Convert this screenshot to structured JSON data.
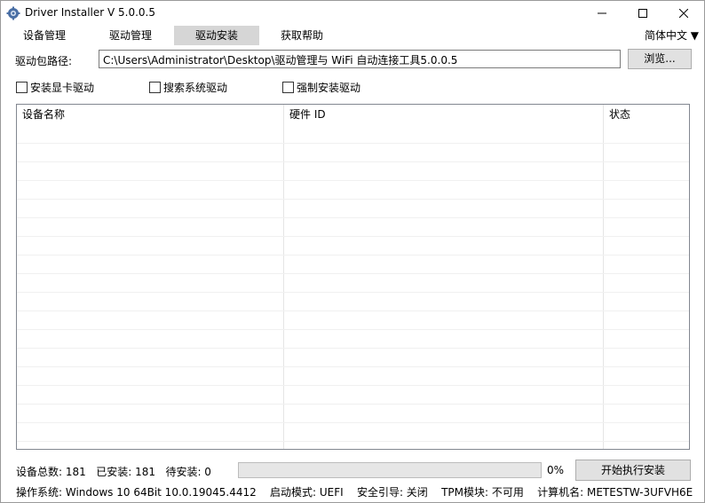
{
  "window": {
    "title": "Driver Installer V 5.0.0.5",
    "icon": "gear-icon"
  },
  "tabs": [
    {
      "label": "设备管理",
      "active": false
    },
    {
      "label": "驱动管理",
      "active": false
    },
    {
      "label": "驱动安装",
      "active": true
    },
    {
      "label": "获取帮助",
      "active": false
    }
  ],
  "language": "简体中文 ▼",
  "path": {
    "label": "驱动包路径:",
    "value": "C:\\Users\\Administrator\\Desktop\\驱动管理与 WiFi 自动连接工具5.0.0.5",
    "browse_label": "浏览..."
  },
  "options": [
    {
      "label": "安装显卡驱动",
      "checked": false
    },
    {
      "label": "搜索系统驱动",
      "checked": false
    },
    {
      "label": "强制安装驱动",
      "checked": false
    }
  ],
  "table": {
    "columns": [
      "设备名称",
      "硬件 ID",
      "状态"
    ],
    "rows": []
  },
  "stats": {
    "total": "设备总数: 181",
    "installed": "已安装: 181",
    "pending": "待安装: 0"
  },
  "progress": {
    "value": 0,
    "text": "0%",
    "bar_color": "#06b025"
  },
  "start_button": "开始执行安装",
  "status": {
    "os": "操作系统: Windows 10  64Bit  10.0.19045.4412",
    "boot": "启动模式: UEFI",
    "secure_boot": "安全引导: 关闭",
    "tpm": "TPM模块: 不可用",
    "computer": "计算机名: METESTW-3UFVH6E"
  }
}
